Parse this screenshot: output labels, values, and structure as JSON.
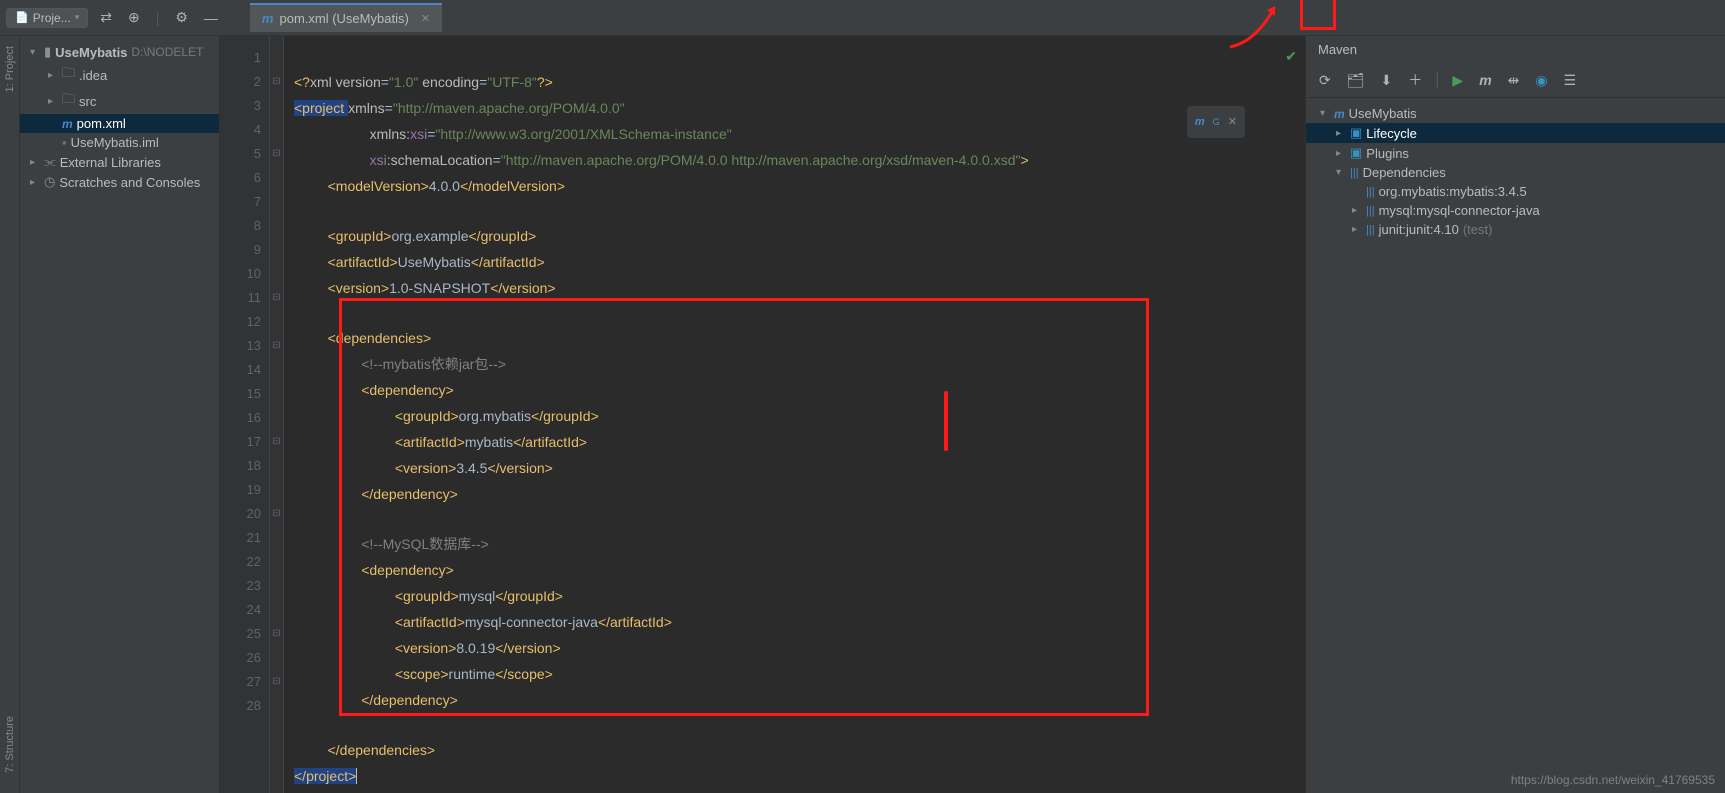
{
  "toolbar": {
    "project_label": "Proje..."
  },
  "tab": {
    "title": "pom.xml (UseMybatis)"
  },
  "tree": {
    "root": {
      "name": "UseMybatis",
      "path": "D:\\NODELET"
    },
    "idea": ".idea",
    "src": "src",
    "pom": "pom.xml",
    "iml": "UseMybatis.iml",
    "ext": "External Libraries",
    "scratch": "Scratches and Consoles"
  },
  "sidebar": {
    "project": "1: Project",
    "structure": "7: Structure"
  },
  "code": {
    "l1": {
      "a": "<?",
      "b": "xml version",
      "c": "=",
      "d": "\"1.0\"",
      "e": " encoding",
      "f": "=",
      "g": "\"UTF-8\"",
      "h": "?>"
    },
    "l2": {
      "a": "<project ",
      "b": "xmlns",
      "c": "=",
      "d": "\"http://maven.apache.org/POM/4.0.0\""
    },
    "l3": {
      "a": "xmlns:",
      "b": "xsi",
      "c": "=",
      "d": "\"http://www.w3.org/2001/XMLSchema-instance\""
    },
    "l4": {
      "a": "xsi",
      "b": ":schemaLocation",
      "c": "=",
      "d": "\"http://maven.apache.org/POM/4.0.0 http://maven.apache.org/xsd/maven-4.0.0.xsd\"",
      "e": ">"
    },
    "l5": {
      "a": "<modelVersion>",
      "b": "4.0.0",
      "c": "</modelVersion>"
    },
    "l7": {
      "a": "<groupId>",
      "b": "org.example",
      "c": "</groupId>"
    },
    "l8": {
      "a": "<artifactId>",
      "b": "UseMybatis",
      "c": "</artifactId>"
    },
    "l9": {
      "a": "<version>",
      "b": "1.0-SNAPSHOT",
      "c": "</version>"
    },
    "l11": {
      "a": "<dependencies>"
    },
    "l12": {
      "a": "<!--mybatis依赖jar包-->"
    },
    "l13": {
      "a": "<dependency>"
    },
    "l14": {
      "a": "<groupId>",
      "b": "org.mybatis",
      "c": "</groupId>"
    },
    "l15": {
      "a": "<artifactId>",
      "b": "mybatis",
      "c": "</artifactId>"
    },
    "l16": {
      "a": "<version>",
      "b": "3.4.5",
      "c": "</version>"
    },
    "l17": {
      "a": "</dependency>"
    },
    "l19": {
      "a": "<!--MySQL数据库-->"
    },
    "l20": {
      "a": "<dependency>"
    },
    "l21": {
      "a": "<groupId>",
      "b": "mysql",
      "c": "</groupId>"
    },
    "l22": {
      "a": "<artifactId>",
      "b": "mysql-connector-java",
      "c": "</artifactId>"
    },
    "l23": {
      "a": "<version>",
      "b": "8.0.19",
      "c": "</version>"
    },
    "l24": {
      "a": "<scope>",
      "b": "runtime",
      "c": "</scope>"
    },
    "l25": {
      "a": "</dependency>"
    },
    "l27": {
      "a": "</dependencies>"
    },
    "l28": {
      "a": "</project>"
    }
  },
  "badge": {
    "label": "m",
    "sub": "G"
  },
  "maven": {
    "title": "Maven",
    "root": "UseMybatis",
    "lifecycle": "Lifecycle",
    "plugins": "Plugins",
    "deps": "Dependencies",
    "dep1": "org.mybatis:mybatis:3.4.5",
    "dep2": "mysql:mysql-connector-java",
    "dep3": "junit:junit:4.10",
    "dep3s": " (test)"
  },
  "watermark": "https://blog.csdn.net/weixin_41769535",
  "lines": [
    "1",
    "2",
    "3",
    "4",
    "5",
    "6",
    "7",
    "8",
    "9",
    "10",
    "11",
    "12",
    "13",
    "14",
    "15",
    "16",
    "17",
    "18",
    "19",
    "20",
    "21",
    "22",
    "23",
    "24",
    "25",
    "26",
    "27",
    "28"
  ]
}
